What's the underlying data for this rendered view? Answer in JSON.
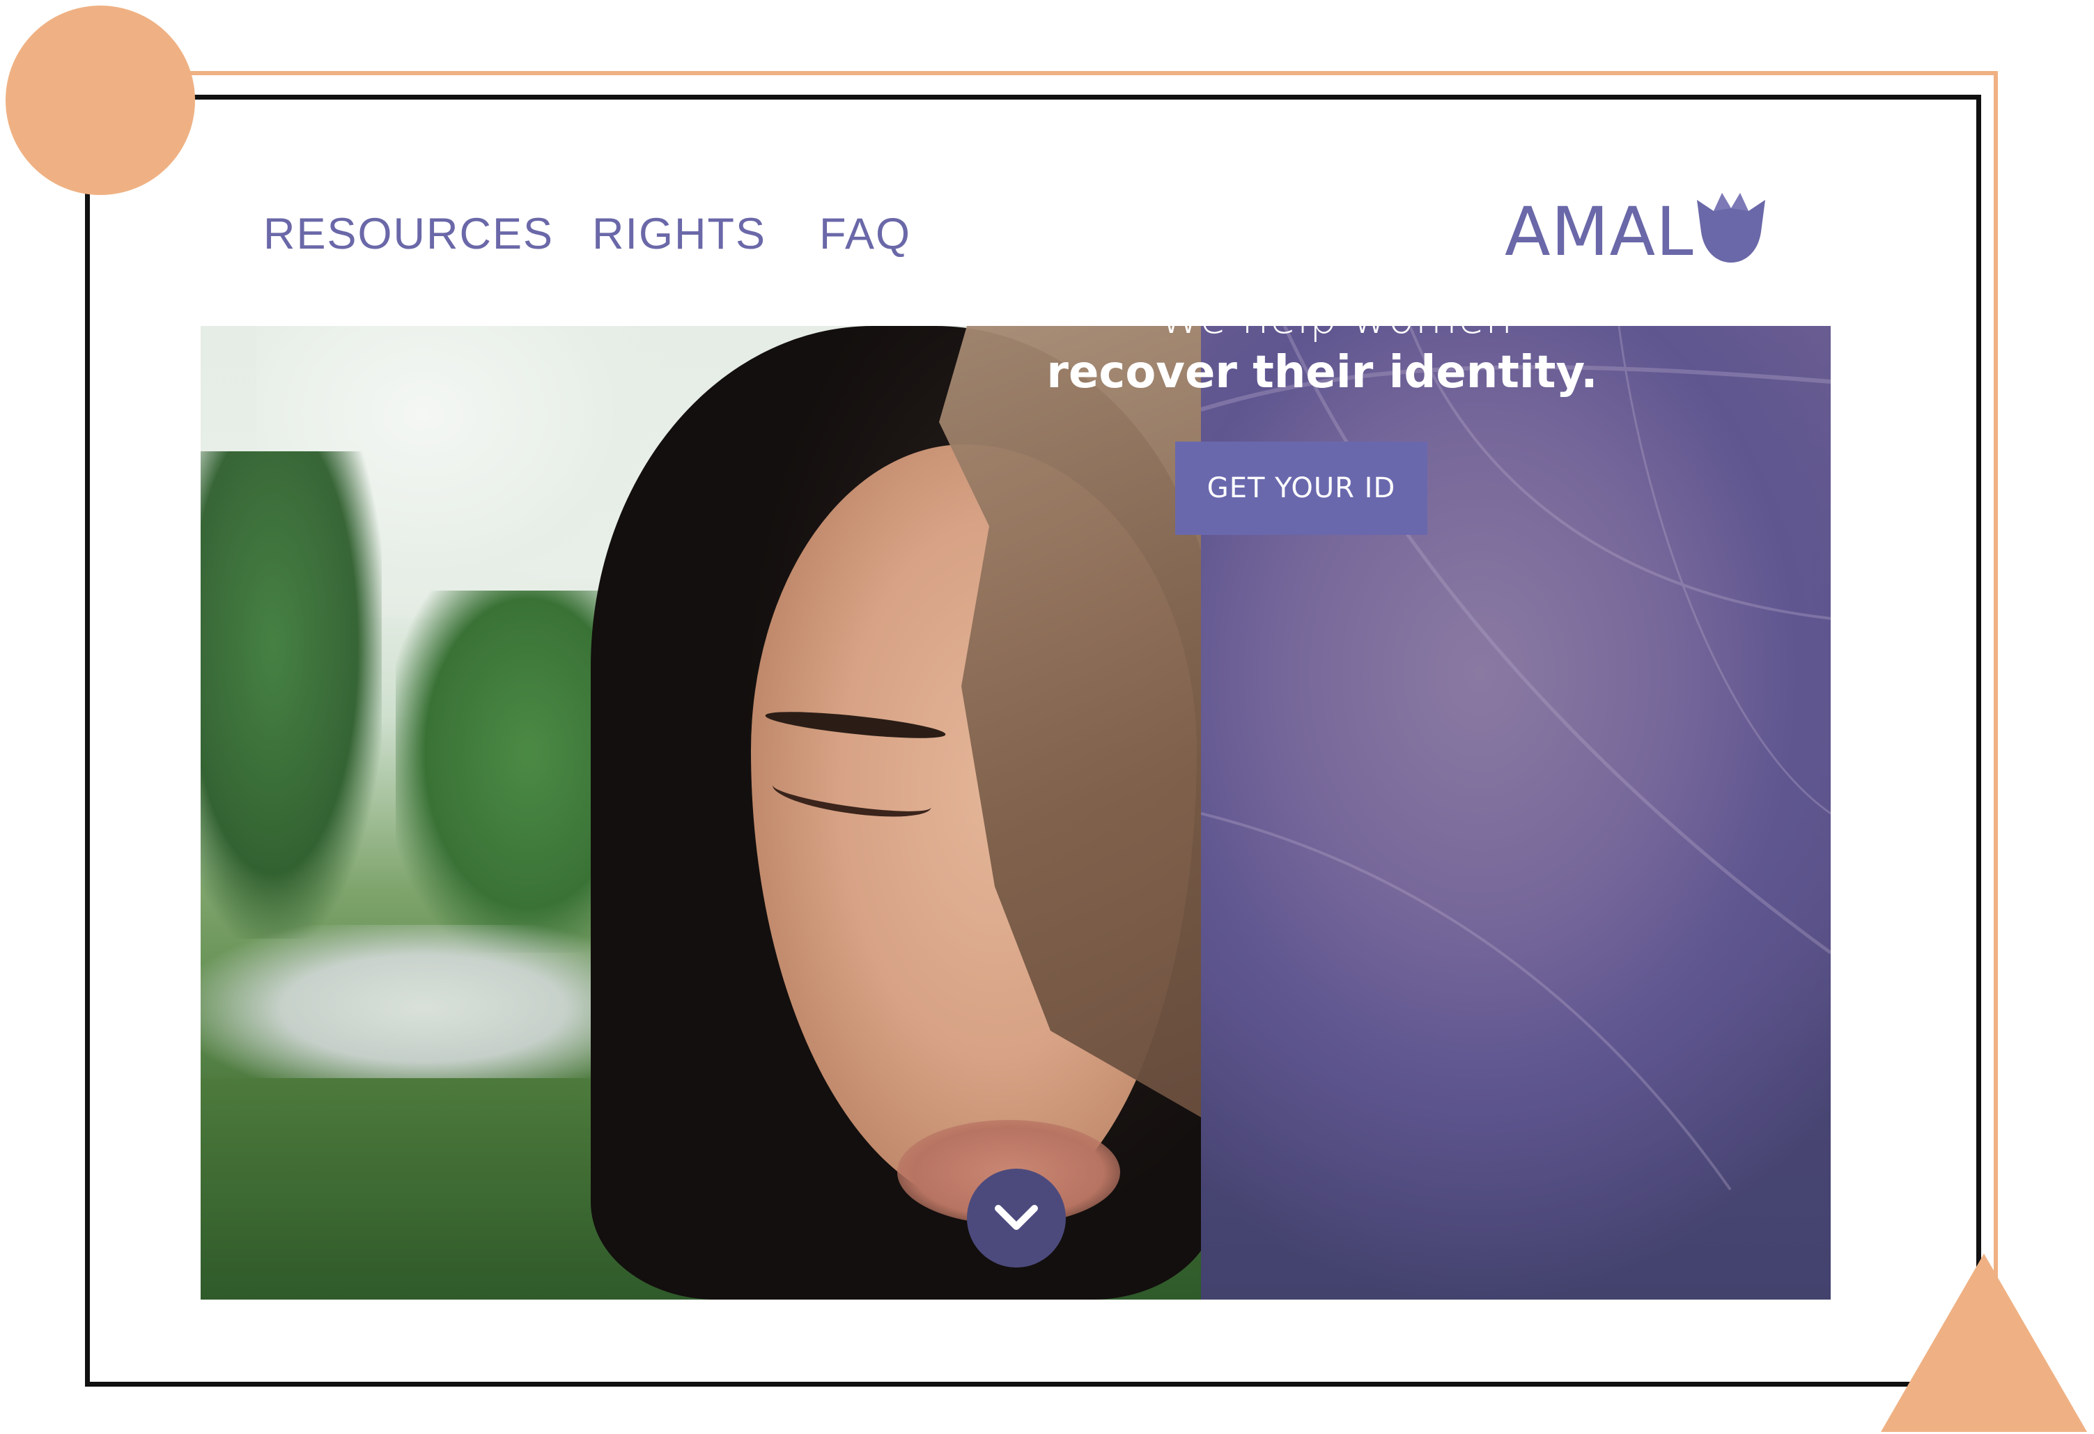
{
  "nav": {
    "items": [
      {
        "label": "RESOURCES"
      },
      {
        "label": "RIGHTS"
      },
      {
        "label": "FAQ"
      }
    ]
  },
  "logo": {
    "text": "AMAL",
    "icon": "tulip-icon"
  },
  "hero": {
    "tagline_line1": "We help women",
    "tagline_line2": "recover their identity.",
    "cta_label": "GET YOUR ID",
    "scroll_icon": "chevron-down-icon"
  },
  "colors": {
    "brand_purple": "#6a68a8",
    "button_purple": "#6a68ad",
    "panel_purple": "#5d5487",
    "accent_orange": "#efb183",
    "frame_black": "#111111"
  }
}
